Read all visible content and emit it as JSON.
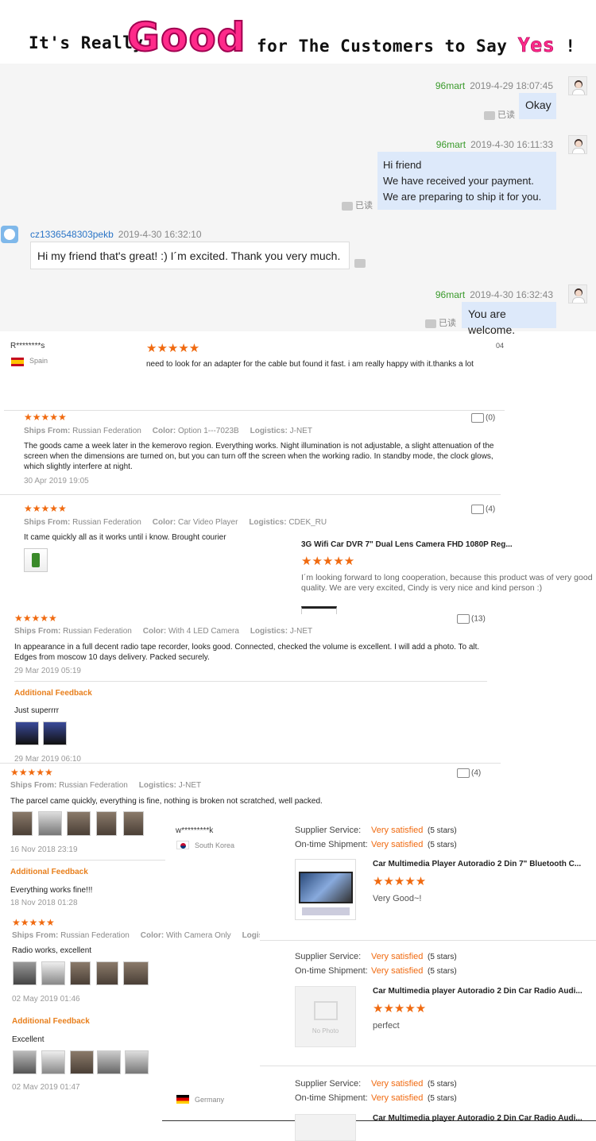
{
  "banner": {
    "part1": "It's Really",
    "good": "Good",
    "part2": "for The Customers to Say",
    "yes": "Yes",
    "bang": "!"
  },
  "chat": {
    "read_label": "已读",
    "messages": [
      {
        "name": "96mart",
        "time": "2019-4-29 18:07:45",
        "lines": [
          "Okay"
        ]
      },
      {
        "name": "96mart",
        "time": "2019-4-30 16:11:33",
        "lines": [
          "Hi friend",
          "We have received your payment.",
          "We are preparing to ship it for you."
        ]
      },
      {
        "name": "cz1336548303pekb",
        "time": "2019-4-30 16:32:10",
        "lines": [
          "Hi my friend that's great! :) I´m excited. Thank you very much."
        ]
      },
      {
        "name": "96mart",
        "time": "2019-4-30 16:32:43",
        "lines": [
          "You are welcome."
        ]
      }
    ]
  },
  "stars": "★★★★★",
  "review_top": {
    "user": "R********s",
    "country": "Spain",
    "text": "need to look for an adapter for the cable but found it fast. i am really happy with it.thanks a lot",
    "corner": "04"
  },
  "labels": {
    "ships_from": "Ships From:",
    "color": "Color:",
    "logistics": "Logistics:",
    "additional": "Additional Feedback"
  },
  "reviews": [
    {
      "ships": "Russian Federation",
      "color": "Option 1---7023B",
      "logistics": "J-NET",
      "likes": "(0)",
      "text": "The goods came a week later in the kemerovo region. Everything works. Night illumination is not adjustable, a slight attenuation of the screen when the dimensions are turned on, but you can turn off the screen when the working radio. In standby mode, the clock glows, which slightly interfere at night.",
      "date": "30 Apr 2019 19:05"
    },
    {
      "ships": "Russian Federation",
      "color": "Car Video Player",
      "logistics": "CDEK_RU",
      "likes": "(4)",
      "text": "It came quickly all as it works until i know. Brought courier"
    },
    {
      "ships": "Russian Federation",
      "color": "With 4 LED Camera",
      "logistics": "J-NET",
      "likes": "(13)",
      "text": "In appearance in a full decent radio tape recorder, looks good. Connected, checked the volume is excellent. I will add a photo. To alt. Edges from moscow 10 days delivery. Packed securely.",
      "date": "29 Mar 2019 05:19",
      "additional": "Just superrrr",
      "add_date": "29 Mar 2019 06:10"
    },
    {
      "ships": "Russian Federation",
      "logistics": "J-NET",
      "likes": "(4)",
      "text": "The parcel came quickly, everything is fine, nothing is broken not scratched, well packed.",
      "date": "16 Nov 2018 23:19",
      "additional": "Everything works fine!!!",
      "add_date": "18 Nov 2018 01:28"
    },
    {
      "ships": "Russian Federation",
      "color": "With Camera Only",
      "logistics": "Logistic",
      "text": "Radio works, excellent",
      "date": "02 May 2019 01:46",
      "additional": "Excellent",
      "add_date": "02 May 2019 01:47"
    }
  ],
  "side_review": {
    "title": "3G Wifi Car DVR 7\" Dual Lens Camera FHD 1080P Reg...",
    "text": "I´m looking forward to long cooperation, because this product was of very good quality. We are very excited, Cindy is very nice and kind person :)"
  },
  "supplier": {
    "service_label": "Supplier Service:",
    "shipment_label": "On-time Shipment:",
    "satisfied": "Very satisfied",
    "five": "(5 stars)",
    "no_photo": "No Photo",
    "blocks": [
      {
        "user": "w*********k",
        "country": "South Korea",
        "title": "Car Multimedia Player Autoradio 2 Din 7\" Bluetooth C...",
        "comment": "Very Good~!"
      },
      {
        "title": "Car Multimedia player Autoradio 2 Din Car Radio Audi...",
        "comment": "perfect"
      },
      {
        "country": "Germany",
        "title": "Car Multimedia player Autoradio 2 Din Car Radio Audi..."
      }
    ]
  }
}
